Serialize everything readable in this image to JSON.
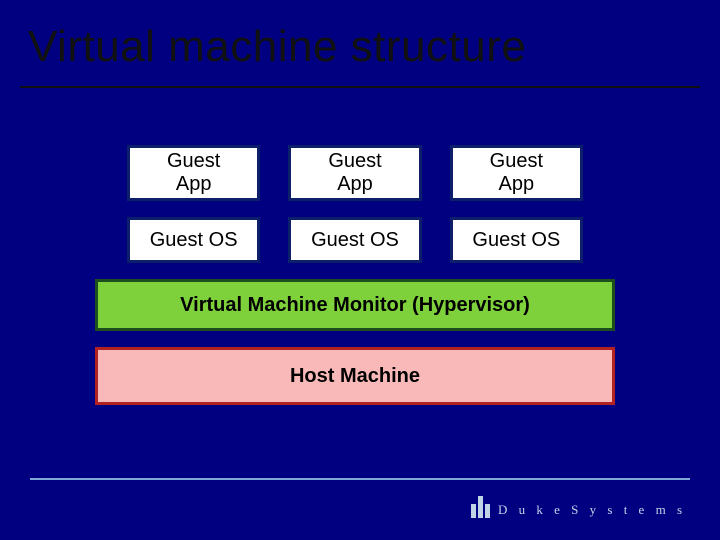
{
  "title": "Virtual machine structure",
  "guests": [
    {
      "app": "Guest\nApp",
      "os": "Guest OS"
    },
    {
      "app": "Guest\nApp",
      "os": "Guest OS"
    },
    {
      "app": "Guest\nApp",
      "os": "Guest OS"
    }
  ],
  "vmm": "Virtual Machine Monitor (Hypervisor)",
  "host": "Host Machine",
  "branding": "D u k e   S y s t e m s",
  "chart_data": {
    "type": "layered-stack-diagram",
    "layers": [
      {
        "level": 3,
        "items": [
          "Guest App",
          "Guest App",
          "Guest App"
        ]
      },
      {
        "level": 2,
        "items": [
          "Guest OS",
          "Guest OS",
          "Guest OS"
        ]
      },
      {
        "level": 1,
        "items": [
          "Virtual Machine Monitor (Hypervisor)"
        ]
      },
      {
        "level": 0,
        "items": [
          "Host Machine"
        ]
      }
    ],
    "title": "Virtual machine structure"
  }
}
